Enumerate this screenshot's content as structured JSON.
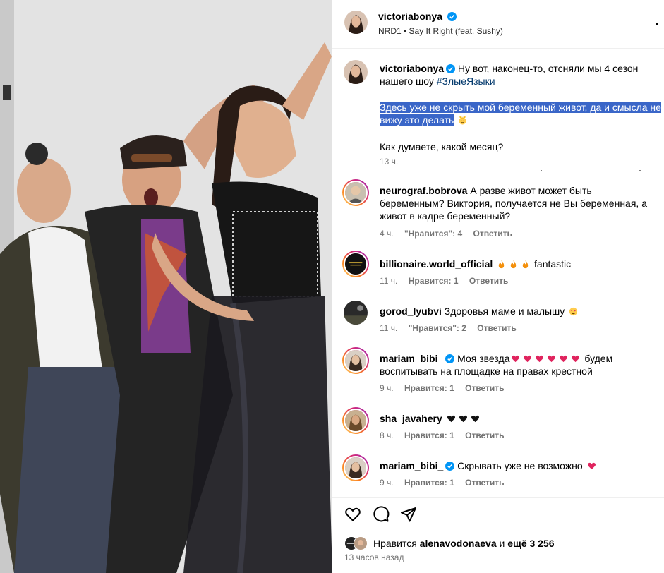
{
  "post": {
    "author": "victoriabonya",
    "audio": "NRD1 • Say It Right (feat. Sushy)",
    "caption_text": "Ну вот, наконец-то, отсняли мы 4 сезон нашего шоу",
    "caption_hashtag": "#ЗлыеЯзыки",
    "caption_selected_1": "Здесь уже не скрыть мой беременный живот, да и смысла не",
    "caption_selected_2": "вижу это делать",
    "caption_question": "Как думаете, какой месяц?",
    "caption_time": "13 ч."
  },
  "comments": [
    {
      "user": "neurograf.bobrova",
      "verified": false,
      "text1": "А разве живот может быть",
      "text2": "беременным? Виктория, получается не Вы беременная, а",
      "text3": "живот в кадре беременный?",
      "time": "4 ч.",
      "likes": "\"Нравится\": 4",
      "reply": "Ответить"
    },
    {
      "user": "billionaire.world_official",
      "verified": false,
      "text1": "fantastic",
      "time": "11 ч.",
      "likes": "Нравится: 1",
      "reply": "Ответить"
    },
    {
      "user": "gorod_lyubvi",
      "verified": false,
      "text1": "Здоровья маме и малышу",
      "time": "11 ч.",
      "likes": "\"Нравится\": 2",
      "reply": "Ответить"
    },
    {
      "user": "mariam_bibi_",
      "verified": true,
      "text1": "Моя звезда",
      "text1b": "будем",
      "text2": "воспитывать на площадке на правах крестной",
      "time": "9 ч.",
      "likes": "Нравится: 1",
      "reply": "Ответить"
    },
    {
      "user": "sha_javahery",
      "verified": false,
      "text1": "",
      "time": "8 ч.",
      "likes": "Нравится: 1",
      "reply": "Ответить"
    },
    {
      "user": "mariam_bibi_",
      "verified": true,
      "text1": "Скрывать уже не возможно",
      "time": "9 ч.",
      "likes": "Нравится: 1",
      "reply": "Ответить"
    }
  ],
  "footer": {
    "likes_prefix": "Нравится",
    "likes_user": "alenavodonaeva",
    "likes_mid": "и",
    "likes_more": "ещё 3 256",
    "time": "13 часов назад"
  },
  "icons": {
    "like": "heart-icon",
    "comment": "comment-icon",
    "share": "paper-plane-icon",
    "more": "more-dots-icon",
    "verified": "verified-badge-icon"
  },
  "colors": {
    "verified": "#0095f6",
    "highlight": "#3a66c8",
    "muted": "#737373",
    "link": "#00376b",
    "emoji_red": "#e0245e",
    "emoji_fire": "#f4900c"
  }
}
